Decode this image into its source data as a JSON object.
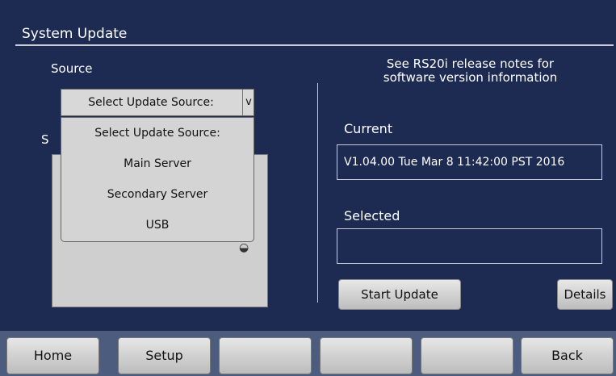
{
  "header": {
    "title": "System Update"
  },
  "source": {
    "label": "Source",
    "hidden_label": "S",
    "select_value": "Select Update Source:",
    "arrow": "v",
    "options": [
      "Select Update Source:",
      "Main Server",
      "Secondary Server",
      "USB"
    ]
  },
  "notes": {
    "line1": "See RS20i release notes for",
    "line2": "software version information"
  },
  "current": {
    "label": "Current",
    "value": "V1.04.00 Tue Mar 8 11:42:00 PST 2016"
  },
  "selected": {
    "label": "Selected",
    "value": ""
  },
  "buttons": {
    "start": "Start Update",
    "details": "Details"
  },
  "nav": {
    "home": "Home",
    "setup": "Setup",
    "blank1": "",
    "blank2": "",
    "blank3": "",
    "back": "Back"
  },
  "colors": {
    "background": "#1d2a52",
    "bottom_bar": "#4c5c7e",
    "panel": "#cfcfcf"
  }
}
